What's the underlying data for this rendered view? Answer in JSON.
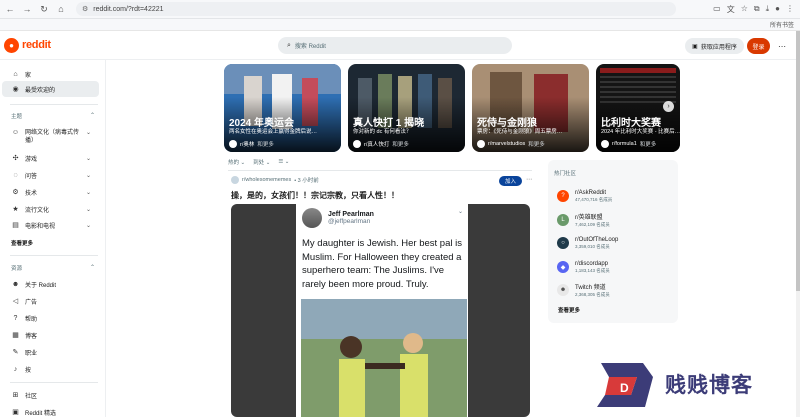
{
  "browser": {
    "url": "reddit.com/?rdt=42221",
    "all_bookmarks": "所有书签"
  },
  "header": {
    "logo_text": "reddit",
    "search_placeholder": "搜索 Reddit",
    "get_app_label": "获取应用程序",
    "login_label": "登录",
    "more_label": "⋯"
  },
  "sidebar": {
    "top_items": [
      {
        "label": "家",
        "icon": "home-icon"
      },
      {
        "label": "最受欢迎的",
        "icon": "popular-icon"
      }
    ],
    "topics_heading": "主题",
    "topics": [
      {
        "label": "网络文化（病毒式传播）",
        "icon": "internet-culture-icon"
      },
      {
        "label": "游戏",
        "icon": "gamepad-icon"
      },
      {
        "label": "问答",
        "icon": "qa-icon"
      },
      {
        "label": "技术",
        "icon": "technology-icon"
      },
      {
        "label": "流行文化",
        "icon": "pop-culture-icon"
      },
      {
        "label": "电影和电视",
        "icon": "movie-icon"
      }
    ],
    "see_more": "查看更多",
    "resources_heading": "资源",
    "resources": [
      {
        "label": "关于 Reddit",
        "icon": "reddit-icon"
      },
      {
        "label": "广告",
        "icon": "megaphone-icon"
      },
      {
        "label": "帮助",
        "icon": "help-icon"
      },
      {
        "label": "博客",
        "icon": "blog-icon"
      },
      {
        "label": "职业",
        "icon": "wrench-icon"
      },
      {
        "label": "按",
        "icon": "mic-icon"
      }
    ],
    "bottom_items": [
      {
        "label": "社区",
        "icon": "community-icon"
      },
      {
        "label": "Reddit 精选",
        "icon": "best-of-icon"
      }
    ]
  },
  "carousel": [
    {
      "title": "2024 年奥运会",
      "desc": "两名女性在奥运会上赢得金牌后说…",
      "sub": "r/奥林",
      "extra": "和更多",
      "colors": [
        "#2b6fb6",
        "#c9d8e6"
      ]
    },
    {
      "title": "真人快打 1 揭晓",
      "desc": "你对新的 dc 有何看法？",
      "sub": "r/真人快打",
      "extra": "和更多",
      "colors": [
        "#203040",
        "#586a78"
      ]
    },
    {
      "title": "死侍与金刚狼",
      "desc": "票房：《死侍与金刚狼》周五票房…",
      "sub": "r/marvelstudios",
      "extra": "和更多",
      "colors": [
        "#8a6a4f",
        "#d6c2a8"
      ]
    },
    {
      "title": "比利时大奖赛",
      "desc": "2024 年比利时大奖赛 - 比赛后…",
      "sub": "r/formula1",
      "extra": "和更多",
      "colors": [
        "#181818",
        "#6b1a1a"
      ]
    }
  ],
  "feed": {
    "sort_label": "热的",
    "region_label": "到处",
    "view_label": "☰"
  },
  "post": {
    "subreddit": "r/wholesomememes",
    "time": "• 3 小时前",
    "join_label": "加入",
    "more_label": "⋯",
    "title": "操，是的，女孩们！！宗记宗教，只看人性！！",
    "tweet": {
      "name": "Jeff Pearlman",
      "handle": "@jeffpearlman",
      "text": "My daughter is Jewish. Her best pal is Muslim. For Halloween they created a superhero team: The Juslims. I've rarely been more proud. Truly."
    }
  },
  "popular_communities": {
    "heading": "热门社区",
    "items": [
      {
        "name": "r/AskReddit",
        "members": "47,470,716 名成员",
        "color": "#ff4500",
        "icon": "askreddit-icon"
      },
      {
        "name": "r/英雄联盟",
        "members": "7,462,109 名成员",
        "color": "#6a9a6a",
        "icon": "lol-icon"
      },
      {
        "name": "r/OutOfTheLoop",
        "members": "3,359,010 名成员",
        "color": "#1f3a4a",
        "icon": "loop-icon"
      },
      {
        "name": "r/discordapp",
        "members": "1,183,143 名成员",
        "color": "#5865f2",
        "icon": "discord-icon"
      },
      {
        "name": "Twitch 频道",
        "members": "2,368,305 名成员",
        "color": "#e8e8e8",
        "icon": "twitch-icon"
      }
    ],
    "see_more": "查看更多"
  },
  "watermark": {
    "text": "贱贱博客",
    "mark": "D"
  }
}
